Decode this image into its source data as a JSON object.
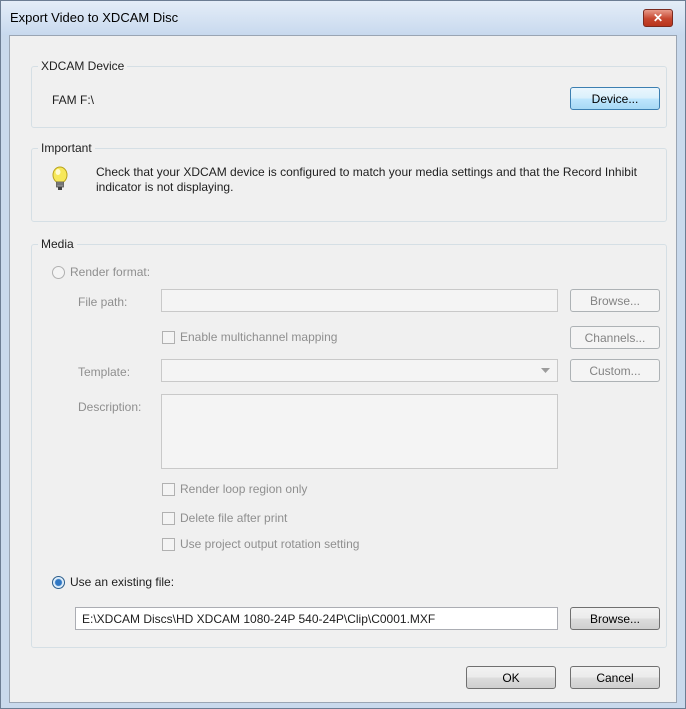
{
  "window": {
    "title": "Export Video to XDCAM Disc",
    "close_glyph": "✕"
  },
  "xdcam_device": {
    "group_label": "XDCAM Device",
    "device_path": "FAM F:\\",
    "device_button": "Device..."
  },
  "important": {
    "group_label": "Important",
    "icon": "lightbulb-icon",
    "message": "Check that your XDCAM device is configured to match your media settings and that the Record Inhibit indicator is not displaying."
  },
  "media": {
    "group_label": "Media",
    "render_format_label": "Render format:",
    "file_path_label": "File path:",
    "file_path_value": "",
    "browse_disabled": "Browse...",
    "multichannel_label": "Enable multichannel mapping",
    "channels_button": "Channels...",
    "template_label": "Template:",
    "template_value": "",
    "custom_button": "Custom...",
    "description_label": "Description:",
    "description_value": "",
    "render_loop_label": "Render loop region only",
    "delete_after_print_label": "Delete file after print",
    "rotation_label": "Use project output rotation setting",
    "use_existing_label": "Use an existing file:",
    "existing_file_path": "E:\\XDCAM Discs\\HD XDCAM 1080-24P 540-24P\\Clip\\C0001.MXF",
    "browse_button": "Browse..."
  },
  "footer": {
    "ok_button": "OK",
    "cancel_button": "Cancel"
  },
  "colors": {
    "accent": "#3c7fb1",
    "close": "#c6462f",
    "disabled_text": "#8f8f8f"
  }
}
